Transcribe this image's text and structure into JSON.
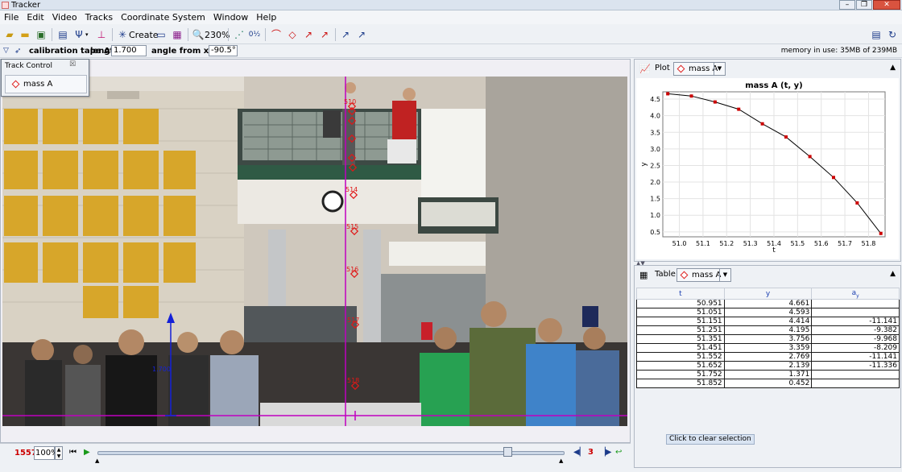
{
  "window": {
    "title": "Tracker",
    "buttons": [
      "–",
      "❐",
      "✕"
    ]
  },
  "menu": [
    "File",
    "Edit",
    "Video",
    "Tracks",
    "Coordinate System",
    "Window",
    "Help"
  ],
  "toolbar": {
    "create_label": "Create",
    "zoom_label": "230%"
  },
  "calibration": {
    "tool_label": "calibration tape A",
    "length_label": "length",
    "length_value": "1.700",
    "angle_label": "angle from x-axis",
    "angle_value": "-90.5°",
    "memory": "memory in use: 35MB of 239MB"
  },
  "track_control": {
    "title": "Track Control",
    "close": "☒",
    "track_button": "mass A"
  },
  "video_overlay": {
    "frame_labels": [
      "510",
      "514",
      "515",
      "516",
      "517",
      "518"
    ],
    "tape_label": "1.700"
  },
  "player": {
    "frame": "1557",
    "zoom": "100%",
    "step": "3"
  },
  "plot_panel": {
    "label": "Plot",
    "track": "mass A",
    "chart_data": {
      "type": "scatter",
      "title": "mass A (t, y)",
      "xlabel": "t",
      "ylabel": "y",
      "xlim": [
        50.93,
        51.87
      ],
      "ylim": [
        0.35,
        4.72
      ],
      "x_ticks": [
        "51.0",
        "51.1",
        "51.2",
        "51.3",
        "51.4",
        "51.5",
        "51.6",
        "51.7",
        "51.8"
      ],
      "y_ticks": [
        "0.5",
        "1.0",
        "1.5",
        "2.0",
        "2.5",
        "3.0",
        "3.5",
        "4.0",
        "4.5"
      ],
      "grid": true,
      "series": [
        {
          "x": [
            50.951,
            51.051,
            51.151,
            51.251,
            51.351,
            51.451,
            51.552,
            51.652,
            51.752,
            51.852
          ],
          "y": [
            4.661,
            4.593,
            4.414,
            4.195,
            3.756,
            3.359,
            2.769,
            2.139,
            1.371,
            0.452
          ],
          "color": "#cc0000"
        }
      ]
    }
  },
  "table_panel": {
    "label": "Table",
    "track": "mass A",
    "columns": [
      "t",
      "y",
      "ay"
    ],
    "rows": [
      [
        "50.951",
        "4.661",
        ""
      ],
      [
        "51.051",
        "4.593",
        ""
      ],
      [
        "51.151",
        "4.414",
        "-11.141"
      ],
      [
        "51.251",
        "4.195",
        "-9.382"
      ],
      [
        "51.351",
        "3.756",
        "-9.968"
      ],
      [
        "51.451",
        "3.359",
        "-8.209"
      ],
      [
        "51.552",
        "2.769",
        "-11.141"
      ],
      [
        "51.652",
        "2.139",
        "-11.336"
      ],
      [
        "51.752",
        "1.371",
        ""
      ],
      [
        "51.852",
        "0.452",
        ""
      ]
    ],
    "clear_selection": "Click to clear selection"
  }
}
